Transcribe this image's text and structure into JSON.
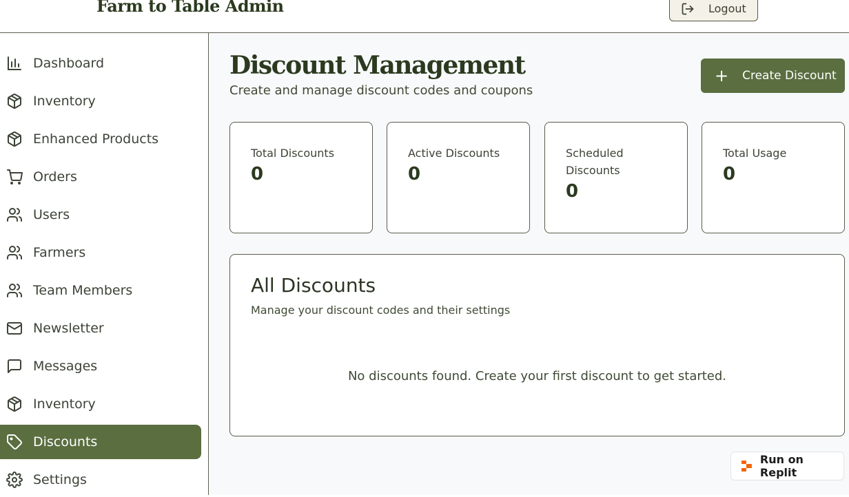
{
  "header": {
    "brand": "Farm to Table Admin",
    "logout_label": "Logout"
  },
  "sidebar": {
    "items": [
      {
        "label": "Dashboard",
        "icon": "bar-chart-icon"
      },
      {
        "label": "Inventory",
        "icon": "package-icon"
      },
      {
        "label": "Enhanced Products",
        "icon": "package-icon"
      },
      {
        "label": "Orders",
        "icon": "cart-icon"
      },
      {
        "label": "Users",
        "icon": "users-icon"
      },
      {
        "label": "Farmers",
        "icon": "users-icon"
      },
      {
        "label": "Team Members",
        "icon": "users-icon"
      },
      {
        "label": "Newsletter",
        "icon": "mail-icon"
      },
      {
        "label": "Messages",
        "icon": "message-icon"
      },
      {
        "label": "Inventory",
        "icon": "package-icon"
      },
      {
        "label": "Discounts",
        "icon": "tag-icon",
        "active": true
      },
      {
        "label": "Settings",
        "icon": "gear-icon"
      }
    ]
  },
  "main": {
    "title": "Discount Management",
    "subtitle": "Create and manage discount codes and coupons",
    "create_button_label": "Create Discount",
    "stats": [
      {
        "label": "Total Discounts",
        "value": "0"
      },
      {
        "label": "Active Discounts",
        "value": "0"
      },
      {
        "label": "Scheduled Discounts",
        "value": "0"
      },
      {
        "label": "Total Usage",
        "value": "0"
      }
    ],
    "panel": {
      "title": "All Discounts",
      "subtitle": "Manage your discount codes and their settings",
      "empty_message": "No discounts found. Create your first discount to get started."
    }
  },
  "badge": {
    "label": "Run on Replit"
  },
  "colors": {
    "accent": "#5a6e40",
    "border": "#5b5b4e",
    "heading": "#2b3a1f"
  }
}
